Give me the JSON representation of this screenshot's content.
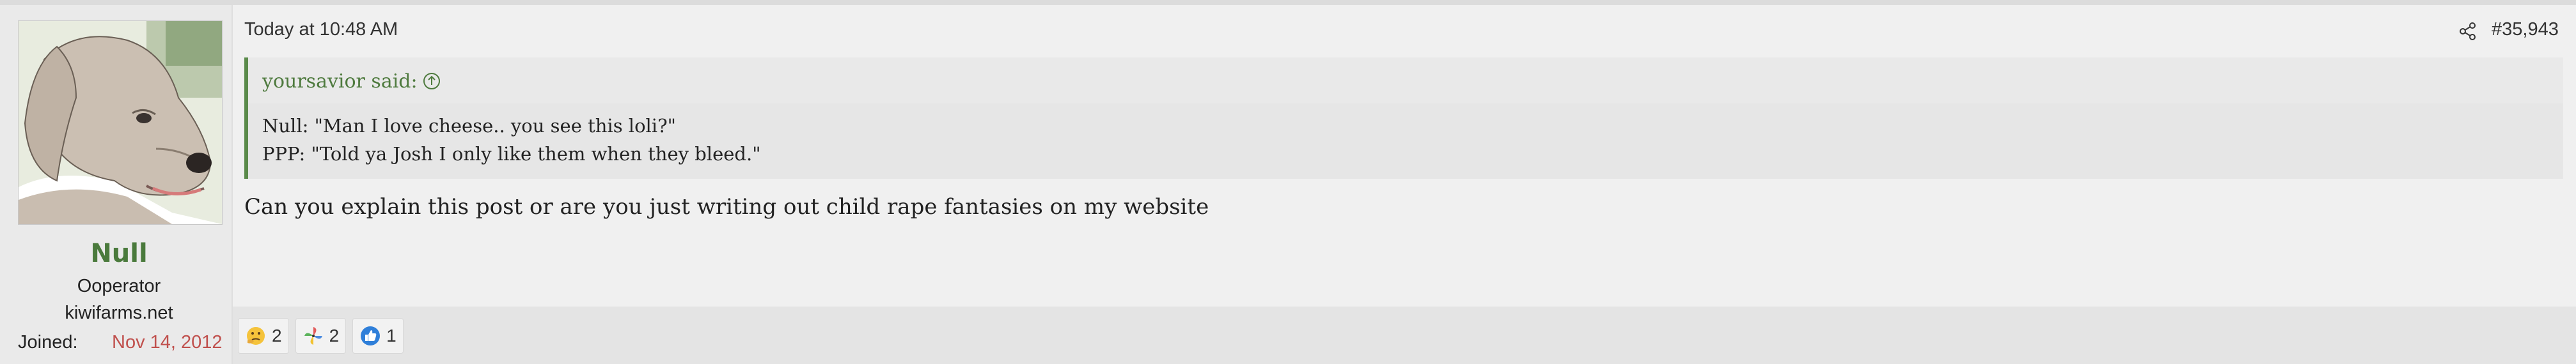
{
  "user": {
    "name": "Null",
    "title": "Ooperator",
    "banner": "kiwifarms.net",
    "joined_label": "Joined:",
    "joined_date": "Nov 14, 2012",
    "avatar_icon": "dog-avatar"
  },
  "post": {
    "timestamp": "Today at 10:48 AM",
    "number": "#35,943",
    "share_icon": "share-icon",
    "quote": {
      "author": "yoursavior said:",
      "arrow_icon": "arrow-up-circle-icon",
      "lines": [
        "Null: \"Man I love cheese.. you see this loli?\"",
        "PPP: \"Told ya Josh I only like them when they bleed.\""
      ]
    },
    "body": "Can you explain this post or are you just writing out child rape fantasies on my website"
  },
  "reactions": [
    {
      "icon": "thinking-face-icon",
      "count": "2"
    },
    {
      "icon": "pinwheel-icon",
      "count": "2"
    },
    {
      "icon": "thumbs-up-icon",
      "count": "1"
    }
  ],
  "colors": {
    "username": "#4a7a3c",
    "quote_border": "#5a8a4a",
    "joined_date": "#c0504d",
    "background": "#f0f0f0"
  }
}
